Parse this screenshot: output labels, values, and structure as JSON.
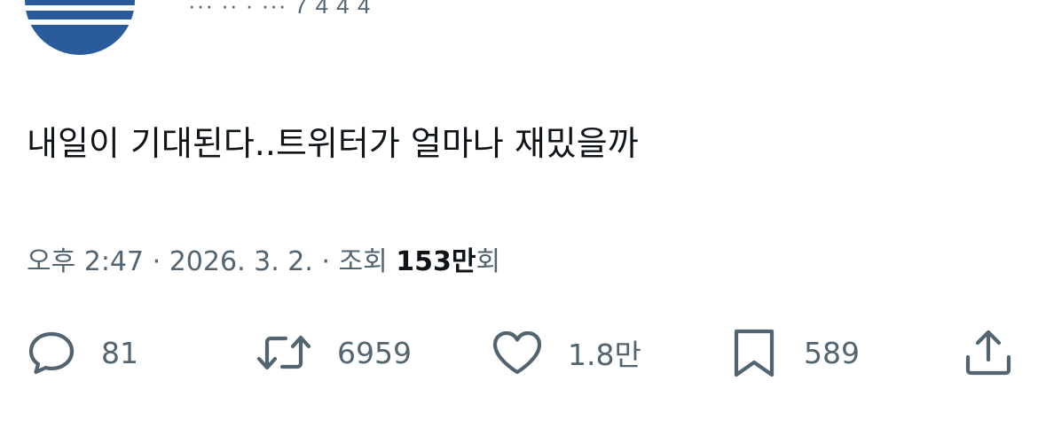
{
  "header": {
    "handle_partial": "··· ·· · ··· 7 4 4 4"
  },
  "tweet": {
    "text": "내일이 기대된다..트위터가 얼마나 재밌을까"
  },
  "meta": {
    "time": "오후 2:47",
    "separator": " · ",
    "date": "2026. 3. 2.",
    "views_label": "조회",
    "views_number": "153",
    "views_unit": "만",
    "views_suffix": "회"
  },
  "actions": {
    "reply_count": "81",
    "retweet_count": "6959",
    "like_count": "1.8만",
    "bookmark_count": "589"
  },
  "icons": {
    "reply": "reply-icon",
    "retweet": "retweet-icon",
    "like": "heart-icon",
    "bookmark": "bookmark-icon",
    "share": "share-icon"
  },
  "colors": {
    "text_primary": "#0f1419",
    "text_secondary": "#536471",
    "avatar_blue": "#2a5b9a"
  }
}
